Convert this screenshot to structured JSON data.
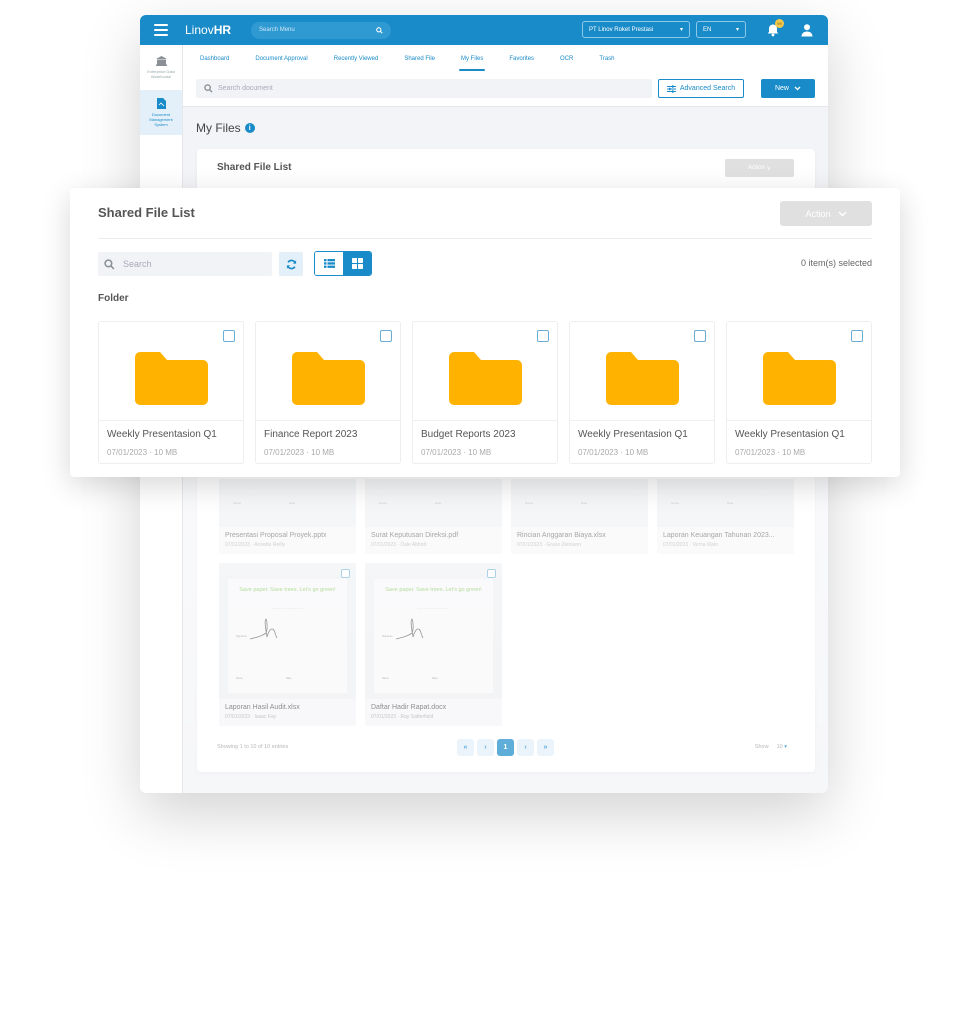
{
  "app": {
    "logo_light": "Linov",
    "logo_bold": "HR",
    "menu_search_placeholder": "Search Menu",
    "company_select": "PT Linov Roket Prestasi",
    "language_select": "EN",
    "notification_count": "99"
  },
  "sidebar": {
    "items": [
      {
        "label": "Enterprise Data Warehouse",
        "icon": "building-icon"
      },
      {
        "label": "Document Management System",
        "icon": "document-icon",
        "active": true
      }
    ]
  },
  "tabs": [
    {
      "label": "Dashboard"
    },
    {
      "label": "Document Approval"
    },
    {
      "label": "Recently Viewed"
    },
    {
      "label": "Shared File"
    },
    {
      "label": "My Files",
      "active": true
    },
    {
      "label": "Favorites"
    },
    {
      "label": "OCR"
    },
    {
      "label": "Trash"
    }
  ],
  "toolbar": {
    "search_placeholder": "Search document",
    "advanced_search_label": "Advanced Search",
    "new_label": "New"
  },
  "page": {
    "title": "My Files"
  },
  "background_card": {
    "title": "Shared File List",
    "action_label": "Action",
    "files": [
      {
        "name": "Presentasi Proposal Proyek.pptx",
        "date": "07/01/2023",
        "owner": "Annette Reilly"
      },
      {
        "name": "Surat Keputusan Direksi.pdf",
        "date": "07/01/2023",
        "owner": "Dale Abbott"
      },
      {
        "name": "Rincian Anggaran Biaya.xlsx",
        "date": "07/01/2023",
        "owner": "Grace Ziemann"
      },
      {
        "name": "Laporan Keuangan Tahunan 2023...",
        "date": "07/01/2023",
        "owner": "Verna Klein"
      },
      {
        "name": "Laporan Hasil Audit.xlsx",
        "date": "07/01/2023",
        "owner": "Isaac Fay"
      },
      {
        "name": "Daftar Hadir Rapat.docx",
        "date": "07/01/2023",
        "owner": "Ray Satterfield"
      }
    ],
    "thumb_text": {
      "green": "Save paper. Save trees. Let's go green!",
      "name": "Name",
      "date": "Date",
      "signature": "Signature"
    },
    "pagination": {
      "showing": "Showing 1 to 10 of 10 entries",
      "first": "«",
      "prev": "‹",
      "current": "1",
      "next": "›",
      "last": "»",
      "show_label": "Show",
      "page_size": "10"
    }
  },
  "overlay": {
    "title": "Shared File List",
    "action_label": "Action",
    "search_placeholder": "Search",
    "selected_text": "0 item(s) selected",
    "folder_section_label": "Folder",
    "folder_color": "#FFB300",
    "folders": [
      {
        "name": "Weekly Presentasion Q1",
        "meta": "07/01/2023 · 10 MB"
      },
      {
        "name": "Finance Report 2023",
        "meta": "07/01/2023 · 10 MB"
      },
      {
        "name": "Budget Reports 2023",
        "meta": "07/01/2023 · 10 MB"
      },
      {
        "name": "Weekly Presentasion Q1",
        "meta": "07/01/2023 · 10 MB"
      },
      {
        "name": "Weekly Presentasion Q1",
        "meta": "07/01/2023 · 10 MB"
      }
    ]
  },
  "colors": {
    "primary": "#1A8BC9",
    "folder": "#FFB300",
    "green_text": "#7CC04B"
  }
}
